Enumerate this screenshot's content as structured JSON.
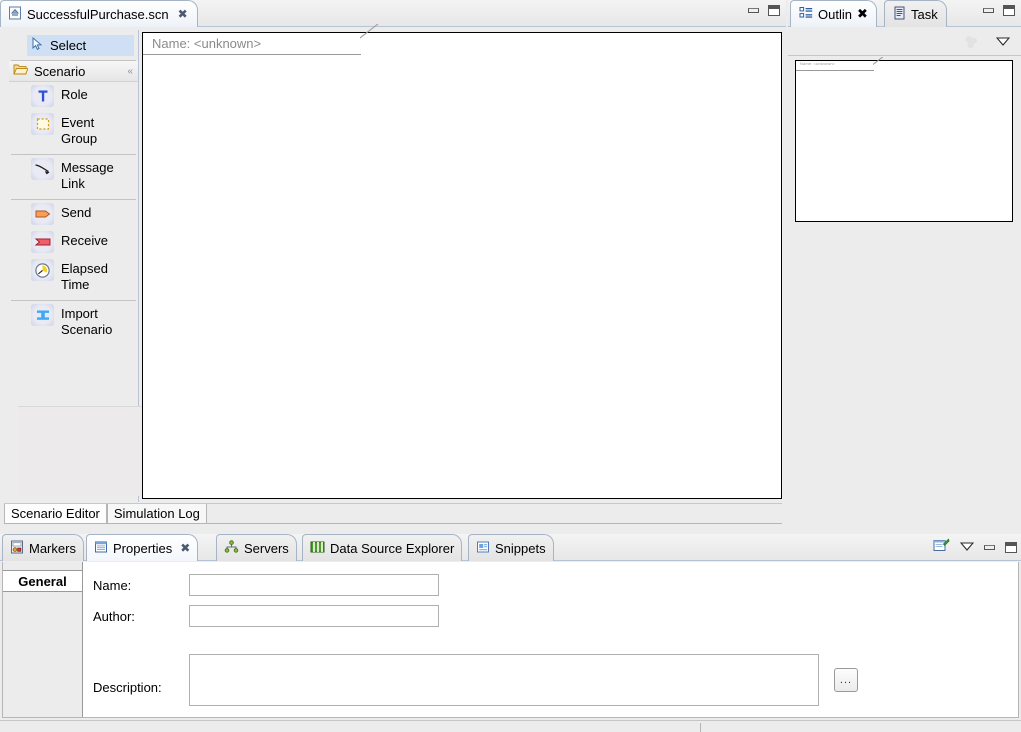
{
  "editor": {
    "tab": {
      "label": "SuccessfulPurchase.scn",
      "icon": "scenario-file-icon",
      "close": "✖"
    },
    "window_controls": {
      "minimize": "minimize-icon",
      "maximize": "maximize-icon"
    },
    "canvas": {
      "name_label": "Name: <unknown>"
    },
    "inner_tabs": [
      {
        "label": "Scenario Editor",
        "selected": true
      },
      {
        "label": "Simulation Log",
        "selected": false
      }
    ]
  },
  "palette": {
    "select": {
      "label": "Select",
      "icon": "cursor-arrow-icon"
    },
    "drawer": {
      "label": "Scenario",
      "icon": "open-folder-icon",
      "pin": "«"
    },
    "items": [
      {
        "label": "Role",
        "icon": "role-t-icon"
      },
      {
        "label": "Event Group",
        "icon": "event-group-icon"
      },
      {
        "label": "Message Link",
        "icon": "message-link-icon"
      },
      {
        "label": "Send",
        "icon": "send-icon"
      },
      {
        "label": "Receive",
        "icon": "receive-icon"
      },
      {
        "label": "Elapsed Time",
        "icon": "elapsed-time-icon"
      },
      {
        "label": "Import Scenario",
        "icon": "import-scenario-icon"
      }
    ]
  },
  "outline": {
    "tabs": [
      {
        "label": "Outlin",
        "icon": "outline-icon",
        "selected": true,
        "close": "✖"
      },
      {
        "label": "Task",
        "icon": "task-icon",
        "selected": false
      }
    ],
    "toolbar": {
      "overview_icon": "overview-disabled-icon",
      "view_menu_icon": "view-menu-chevron-icon"
    },
    "thumbnail": {
      "name_label": "Name: <unknown>"
    }
  },
  "bottom": {
    "tabs": [
      {
        "label": "Markers",
        "icon": "markers-icon",
        "selected": false,
        "close": ""
      },
      {
        "label": "Properties",
        "icon": "properties-icon",
        "selected": true,
        "close": "✖"
      },
      {
        "label": "Servers",
        "icon": "servers-icon",
        "selected": false,
        "close": ""
      },
      {
        "label": "Data Source Explorer",
        "icon": "data-source-explorer-icon",
        "selected": false,
        "close": ""
      },
      {
        "label": "Snippets",
        "icon": "snippets-icon",
        "selected": false,
        "close": ""
      }
    ],
    "toolbar": {
      "pin_icon": "new-properties-view-icon",
      "view_menu_icon": "view-menu-chevron-icon",
      "minimize_icon": "minimize-icon",
      "maximize_icon": "maximize-icon"
    }
  },
  "properties": {
    "section_tabs": [
      {
        "label": "General",
        "selected": true
      }
    ],
    "fields": {
      "name": {
        "label": "Name:",
        "value": "",
        "placeholder": ""
      },
      "author": {
        "label": "Author:",
        "value": "",
        "placeholder": ""
      },
      "description": {
        "label": "Description:",
        "value": "",
        "placeholder": "",
        "browse": "..."
      }
    }
  },
  "colors": {
    "accent_selection": "#cfe0f5",
    "tab_border": "#a6b4c6",
    "panel_bg": "#ececec",
    "canvas_bg": "#ffffff"
  }
}
